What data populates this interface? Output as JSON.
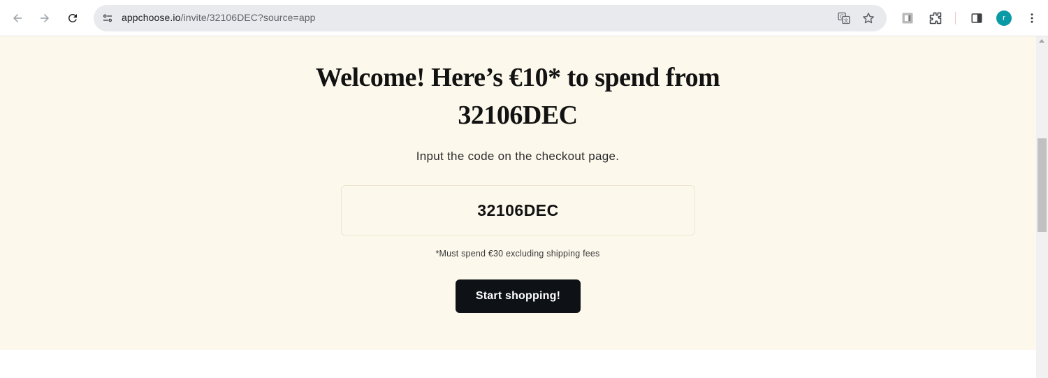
{
  "browser": {
    "url_domain": "appchoose.io",
    "url_path": "/invite/32106DEC?source=app",
    "avatar_letter": "r",
    "avatar_color": "#0a9aa6",
    "icons": {
      "back": "back-arrow-icon",
      "forward": "forward-arrow-icon",
      "reload": "reload-icon",
      "site_info": "site-settings-icon",
      "translate": "translate-icon",
      "bookmark": "star-icon",
      "extension": "extension-icon",
      "extensions_menu": "puzzle-icon",
      "side_panel": "side-panel-icon",
      "menu": "kebab-menu-icon"
    }
  },
  "page": {
    "headline": "Welcome! Here’s €10* to spend from 32106DEC",
    "subline": "Input the code on the checkout page.",
    "code": "32106DEC",
    "fineprint": "*Must spend €30 excluding shipping fees",
    "cta_label": "Start shopping!",
    "colors": {
      "hero_background": "#fcf8ec",
      "cta_background": "#0e1216",
      "cta_text": "#ffffff"
    }
  }
}
